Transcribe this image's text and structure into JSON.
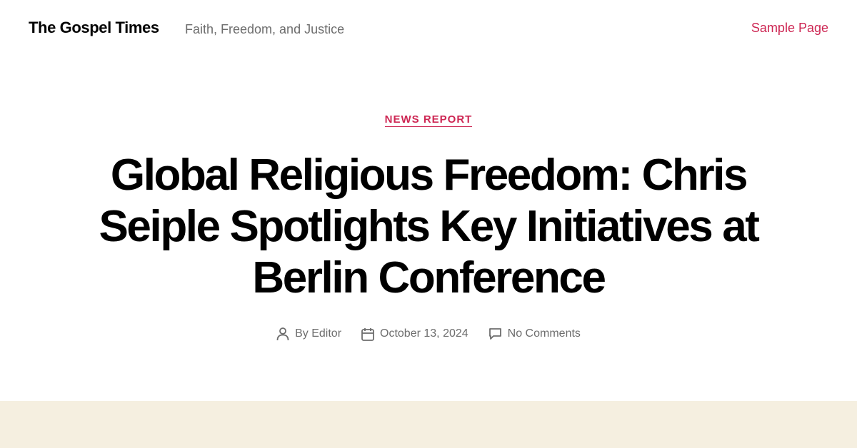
{
  "header": {
    "site_title": "The Gospel Times",
    "tagline": "Faith, Freedom, and Justice",
    "nav": [
      {
        "label": "Sample Page"
      }
    ]
  },
  "entry": {
    "category": "NEWS REPORT",
    "title": "Global Religious Freedom: Chris Seiple Spotlights Key Initiatives at Berlin Conference",
    "meta": {
      "author_prefix": "By",
      "author": "Editor",
      "date": "October 13, 2024",
      "comments": "No Comments",
      "icons": [
        "user-icon",
        "calendar-icon",
        "comment-icon"
      ]
    }
  },
  "colors": {
    "accent": "#cd2653",
    "text": "#000000",
    "muted": "#6d6d6d",
    "band": "#f5efe0"
  }
}
